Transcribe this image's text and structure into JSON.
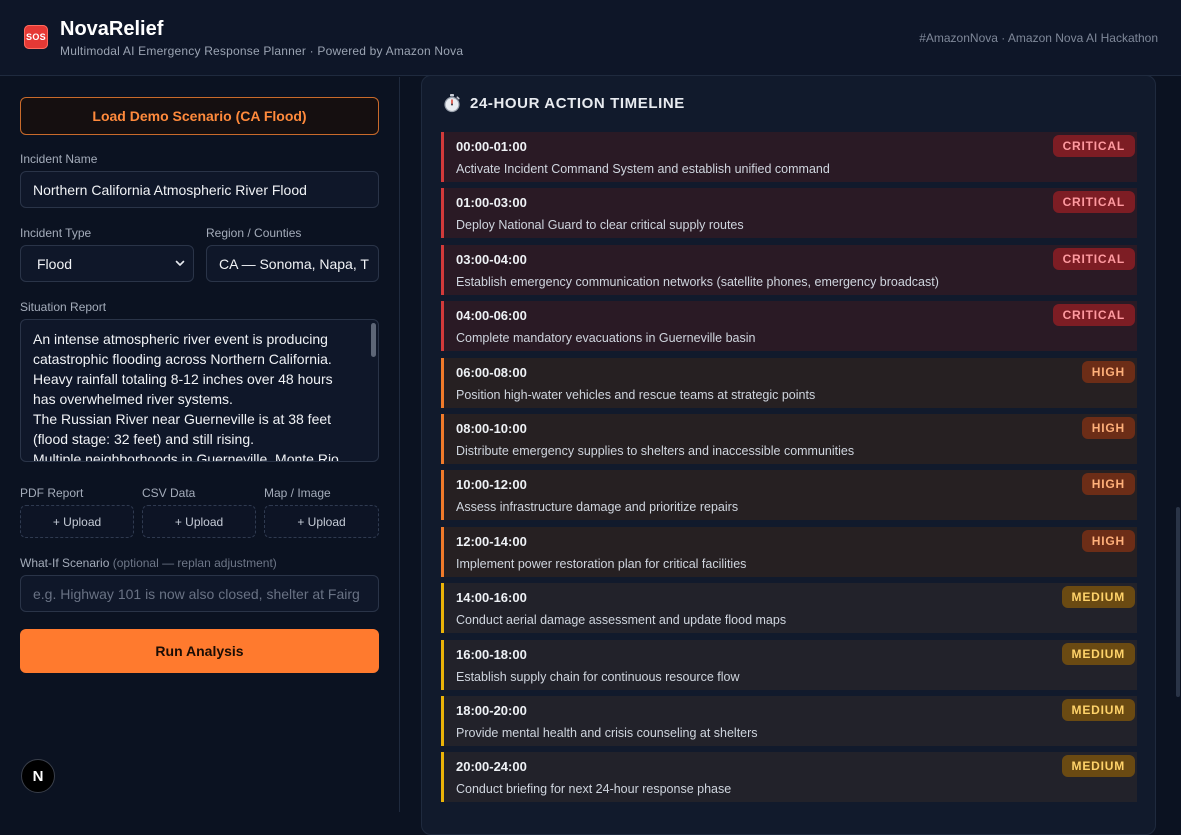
{
  "header": {
    "logo_text": "SOS",
    "title": "NovaRelief",
    "subtitle": "Multimodal AI Emergency Response Planner · Powered by Amazon Nova",
    "right_text": "#AmazonNova · Amazon Nova AI Hackathon"
  },
  "form": {
    "demo_button": "Load Demo Scenario (CA Flood)",
    "incident_name_label": "Incident Name",
    "incident_name_value": "Northern California Atmospheric River Flood",
    "incident_type_label": "Incident Type",
    "incident_type_value": "Flood",
    "region_label": "Region / Counties",
    "region_value": "CA — Sonoma, Napa, T",
    "situation_label": "Situation Report",
    "situation_lines": [
      "An intense atmospheric river event is producing",
      "catastrophic flooding across Northern California.",
      "Heavy rainfall totaling 8-12 inches over 48 hours",
      "has overwhelmed river systems.",
      "The Russian River near Guerneville is at 38 feet",
      "(flood stage: 32 feet) and still rising.",
      "Multiple neighborhoods in Guerneville, Monte Rio,"
    ],
    "uploads": [
      {
        "label": "PDF Report",
        "button": "+ Upload"
      },
      {
        "label": "CSV Data",
        "button": "+ Upload"
      },
      {
        "label": "Map / Image",
        "button": "+ Upload"
      }
    ],
    "whatif_label": "What-If Scenario",
    "whatif_hint": "(optional — replan adjustment)",
    "whatif_placeholder": "e.g. Highway 101 is now also closed, shelter at Fairg",
    "run_button": "Run Analysis"
  },
  "floating_badge": "N",
  "timeline": {
    "title": "24-HOUR ACTION TIMELINE",
    "items": [
      {
        "time": "00:00-01:00",
        "action": "Activate Incident Command System and establish unified command",
        "priority": "CRITICAL"
      },
      {
        "time": "01:00-03:00",
        "action": "Deploy National Guard to clear critical supply routes",
        "priority": "CRITICAL"
      },
      {
        "time": "03:00-04:00",
        "action": "Establish emergency communication networks (satellite phones, emergency broadcast)",
        "priority": "CRITICAL"
      },
      {
        "time": "04:00-06:00",
        "action": "Complete mandatory evacuations in Guerneville basin",
        "priority": "CRITICAL"
      },
      {
        "time": "06:00-08:00",
        "action": "Position high-water vehicles and rescue teams at strategic points",
        "priority": "HIGH"
      },
      {
        "time": "08:00-10:00",
        "action": "Distribute emergency supplies to shelters and inaccessible communities",
        "priority": "HIGH"
      },
      {
        "time": "10:00-12:00",
        "action": "Assess infrastructure damage and prioritize repairs",
        "priority": "HIGH"
      },
      {
        "time": "12:00-14:00",
        "action": "Implement power restoration plan for critical facilities",
        "priority": "HIGH"
      },
      {
        "time": "14:00-16:00",
        "action": "Conduct aerial damage assessment and update flood maps",
        "priority": "MEDIUM"
      },
      {
        "time": "16:00-18:00",
        "action": "Establish supply chain for continuous resource flow",
        "priority": "MEDIUM"
      },
      {
        "time": "18:00-20:00",
        "action": "Provide mental health and crisis counseling at shelters",
        "priority": "MEDIUM"
      },
      {
        "time": "20:00-24:00",
        "action": "Conduct briefing for next 24-hour response phase",
        "priority": "MEDIUM"
      }
    ]
  },
  "colors": {
    "accent": "#ff7a2e",
    "critical": "#d23a3a",
    "high": "#f07a2a",
    "medium": "#eab308",
    "background": "#0b1221"
  }
}
